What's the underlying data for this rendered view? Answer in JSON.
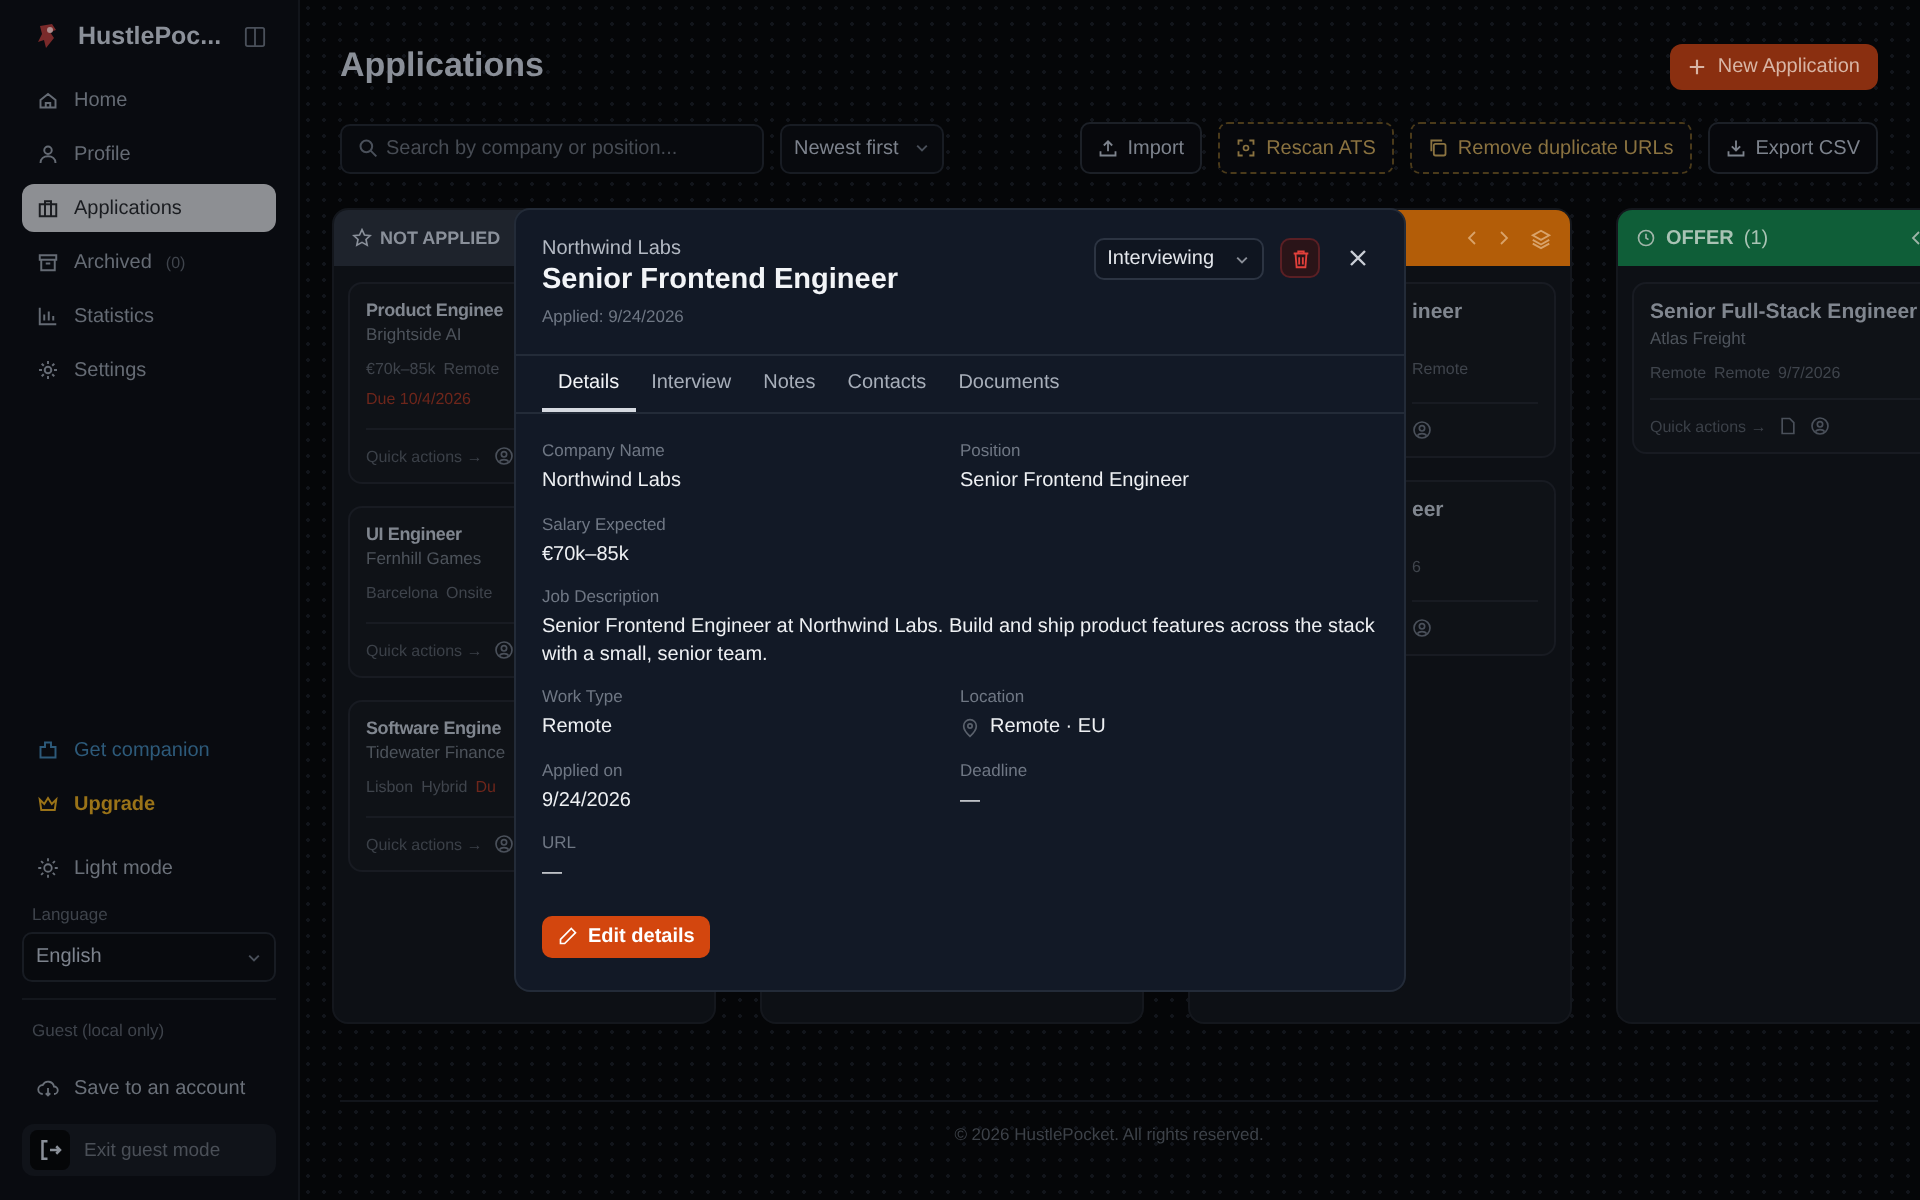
{
  "sidebar": {
    "brand": "HustlePoc...",
    "items": [
      {
        "label": "Home",
        "selected": false
      },
      {
        "label": "Profile",
        "selected": false
      },
      {
        "label": "Applications",
        "selected": true
      },
      {
        "label": "Archived",
        "count": "(0)",
        "selected": false
      },
      {
        "label": "Statistics",
        "selected": false
      },
      {
        "label": "Settings",
        "selected": false
      }
    ],
    "companion": "Get companion",
    "upgrade": "Upgrade",
    "theme": "Light mode",
    "language_label": "Language",
    "language": "English",
    "guest_label": "Guest (local only)",
    "save": "Save to an account",
    "exit": "Exit guest mode"
  },
  "header": {
    "title": "Applications",
    "new_button": "New Application"
  },
  "toolbar": {
    "search_placeholder": "Search by company or position...",
    "sort": "Newest first",
    "buttons": [
      {
        "label": "Import",
        "kind": "plain"
      },
      {
        "label": "Rescan ATS",
        "kind": "warn"
      },
      {
        "label": "Remove duplicate URLs",
        "kind": "warn"
      },
      {
        "label": "Export CSV",
        "kind": "plain"
      }
    ]
  },
  "columns": [
    {
      "kind": "left",
      "title": "NOT APPLIED",
      "color": "#1e232c",
      "cards": [
        {
          "title": "Product Enginee",
          "company": "Brightside AI",
          "meta": [
            "€70k–85k",
            "Remote"
          ],
          "due": "Due 10/4/2026",
          "actions": "Quick actions →"
        },
        {
          "title": "UI Engineer",
          "company": "Fernhill Games",
          "meta": [
            "Barcelona",
            "Onsite"
          ],
          "actions": "Quick actions →"
        },
        {
          "title": "Software Engine",
          "company": "Tidewater Finance",
          "meta": [
            "Lisbon",
            "Hybrid"
          ],
          "due": "Du",
          "actions": "Quick actions →"
        }
      ]
    },
    {
      "kind": "covered"
    },
    {
      "kind": "right",
      "color": "#b35d08",
      "cards": [
        {
          "title": "ineer",
          "meta": [
            "Remote"
          ]
        },
        {
          "title": "eer",
          "meta": [
            "6"
          ]
        }
      ]
    },
    {
      "kind": "full",
      "title": "OFFER",
      "count": "(1)",
      "color": "#0f5e38",
      "cards": [
        {
          "title": "Senior Full-Stack Engineer",
          "company": "Atlas Freight",
          "meta": [
            "Remote",
            "Remote",
            "9/7/2026"
          ],
          "actions": "Quick actions →"
        }
      ]
    }
  ],
  "modal": {
    "company": "Northwind Labs",
    "title": "Senior Frontend Engineer",
    "applied": "Applied: 9/24/2026",
    "status": "Interviewing",
    "tabs": [
      {
        "label": "Details",
        "selected": true
      },
      {
        "label": "Interview",
        "selected": false
      },
      {
        "label": "Notes",
        "selected": false
      },
      {
        "label": "Contacts",
        "selected": false
      },
      {
        "label": "Documents",
        "selected": false
      }
    ],
    "rows": [
      [
        {
          "label": "Company Name",
          "value": "Northwind Labs",
          "kind": "text"
        },
        {
          "label": "Position",
          "value": "Senior Frontend Engineer",
          "kind": "text"
        }
      ],
      [
        {
          "label": "Salary Expected",
          "value": "€70k–85k",
          "kind": "text"
        }
      ],
      [
        {
          "label": "Job Description",
          "value": "Senior Frontend Engineer at Northwind Labs. Build and ship product features across the stack with a small, senior team.",
          "kind": "long"
        }
      ],
      [
        {
          "label": "Work Type",
          "value": "Remote",
          "kind": "text"
        },
        {
          "label": "Location",
          "value": "Remote · EU",
          "kind": "location"
        }
      ],
      [
        {
          "label": "Applied on",
          "value": "9/24/2026",
          "kind": "text"
        },
        {
          "label": "Deadline",
          "value": "—",
          "kind": "text"
        }
      ],
      [
        {
          "label": "URL",
          "value": "—",
          "kind": "text"
        }
      ]
    ],
    "edit_button": "Edit details"
  },
  "footer": "© 2026 HustlePocket. All rights reserved."
}
